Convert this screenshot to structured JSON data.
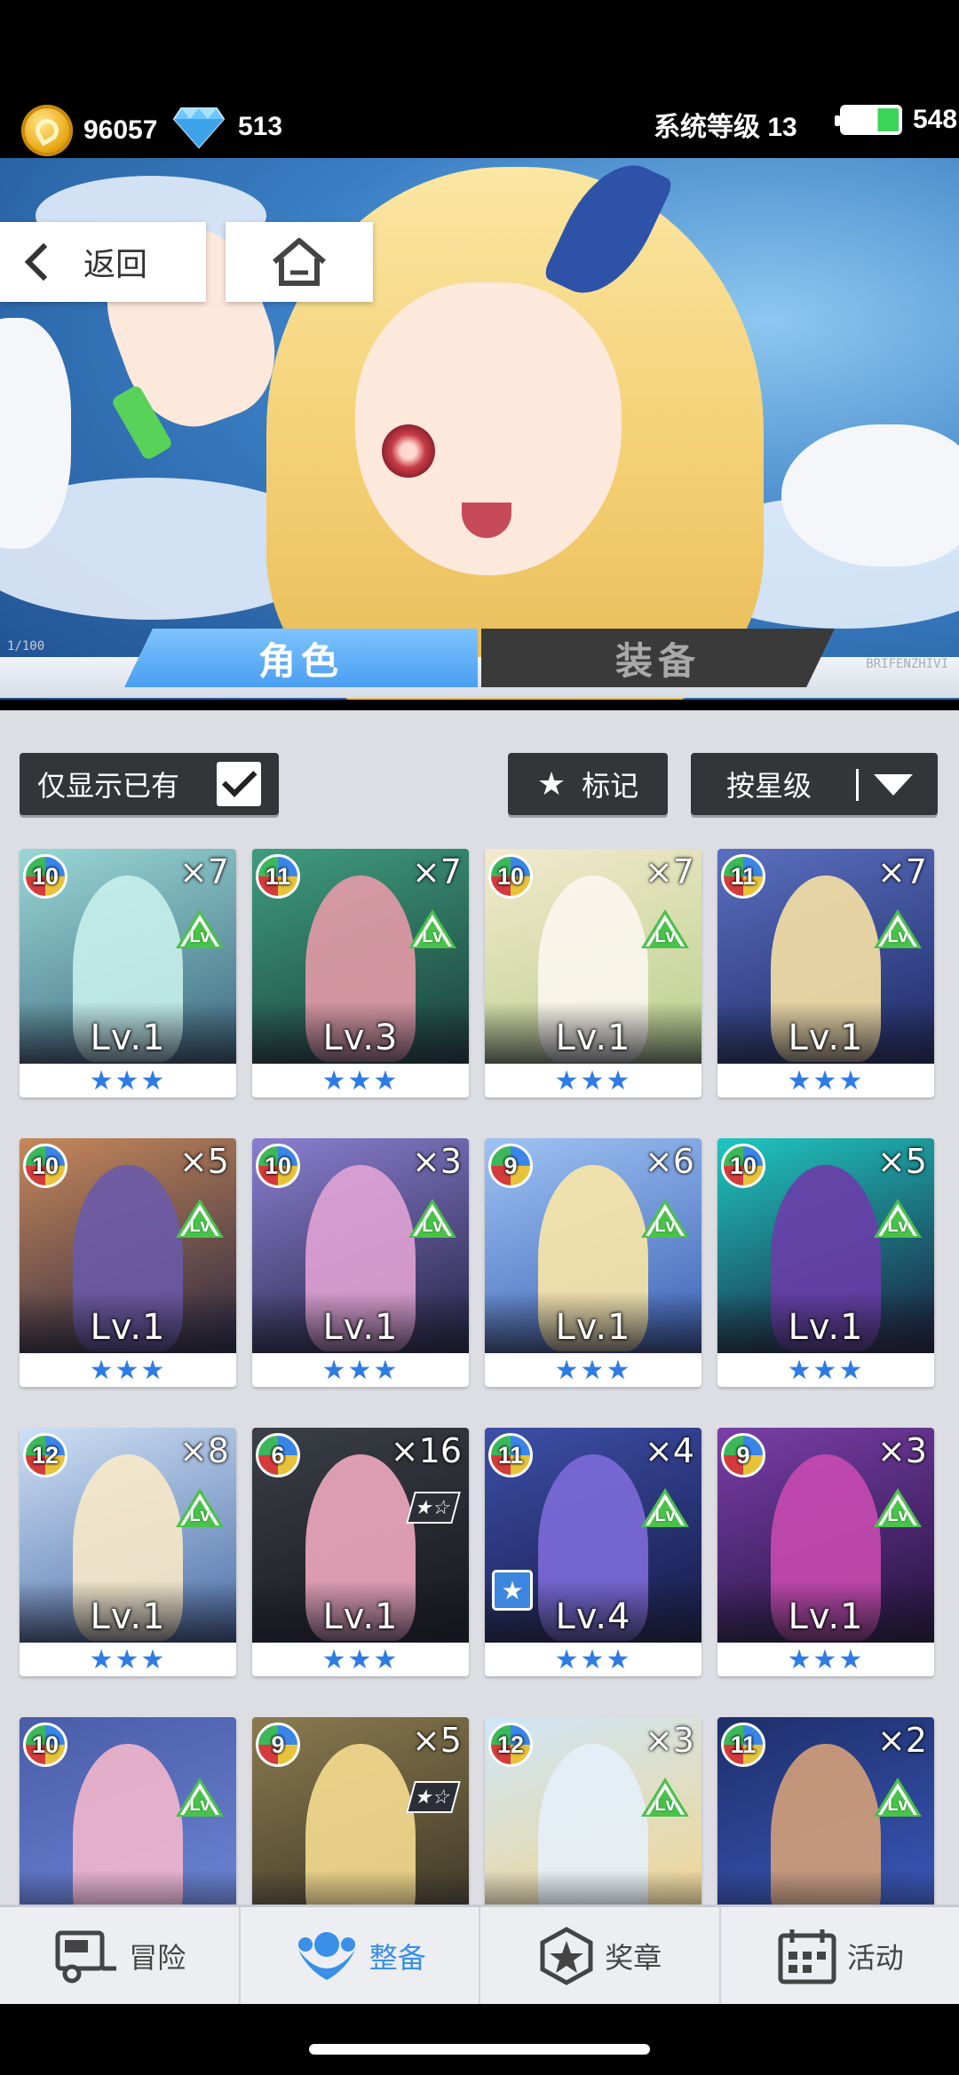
{
  "status": {
    "gold": "96057",
    "gems": "513",
    "system_level_label": "系统等级 13",
    "stamina": "548",
    "icons": {
      "gold": "gold-coin-icon",
      "gems": "diamond-icon",
      "stamina": "battery-icon"
    }
  },
  "header": {
    "back_label": "返回",
    "home_icon": "home-icon",
    "left_tag": "1/100",
    "right_tag": "BRIFENZHIVI"
  },
  "tabs": [
    {
      "label": "角色",
      "active": true
    },
    {
      "label": "装备",
      "active": false
    }
  ],
  "filters": {
    "owned_label": "仅显示已有",
    "owned_checked": true,
    "mark_label": "标记",
    "sort_label": "按星级"
  },
  "cards": [
    {
      "level_badge": "10",
      "count": "×7",
      "lv": "Lv.1",
      "stars": "★★★",
      "art": [
        "#9ad7d5",
        "#3e6a80"
      ],
      "fig": "#c7f0ea",
      "badge": "lv"
    },
    {
      "level_badge": "11",
      "count": "×7",
      "lv": "Lv.3",
      "stars": "★★★",
      "art": [
        "#3f9c7e",
        "#1b3f3a"
      ],
      "fig": "#e49aa8",
      "badge": "lv"
    },
    {
      "level_badge": "10",
      "count": "×7",
      "lv": "Lv.1",
      "stars": "★★★",
      "art": [
        "#f3e9cf",
        "#b9d08a"
      ],
      "fig": "#fbf6ee",
      "badge": "lv"
    },
    {
      "level_badge": "11",
      "count": "×7",
      "lv": "Lv.1",
      "stars": "★★★",
      "art": [
        "#5b6fc0",
        "#1d2a66"
      ],
      "fig": "#f7e1a4",
      "badge": "lv"
    },
    {
      "level_badge": "10",
      "count": "×5",
      "lv": "Lv.1",
      "stars": "★★★",
      "art": [
        "#c6885a",
        "#2b2740"
      ],
      "fig": "#6a5aa8",
      "badge": "lv"
    },
    {
      "level_badge": "10",
      "count": "×3",
      "lv": "Lv.1",
      "stars": "★★★",
      "art": [
        "#8a7fd0",
        "#262244"
      ],
      "fig": "#e0a3d4",
      "badge": "lv"
    },
    {
      "level_badge": "9",
      "count": "×6",
      "lv": "Lv.1",
      "stars": "★★★",
      "art": [
        "#9ec3f3",
        "#3c62b6"
      ],
      "fig": "#fbe7a6",
      "badge": "lv"
    },
    {
      "level_badge": "10",
      "count": "×5",
      "lv": "Lv.1",
      "stars": "★★★",
      "art": [
        "#1fc7c0",
        "#1a1a3a"
      ],
      "fig": "#6a3da8",
      "badge": "lv"
    },
    {
      "level_badge": "12",
      "count": "×8",
      "lv": "Lv.1",
      "stars": "★★★",
      "art": [
        "#cfe0f5",
        "#4b6ea8"
      ],
      "fig": "#f7e9c8",
      "badge": "lv"
    },
    {
      "level_badge": "6",
      "count": "×16",
      "lv": "Lv.1",
      "stars": "★★★",
      "art": [
        "#3b3f46",
        "#15171c"
      ],
      "fig": "#f0a8c0",
      "badge": "star"
    },
    {
      "level_badge": "11",
      "count": "×4",
      "lv": "Lv.4",
      "stars": "★★★",
      "art": [
        "#3d4fa8",
        "#151a45"
      ],
      "fig": "#7d6ad8",
      "badge": "lv",
      "marked": true
    },
    {
      "level_badge": "9",
      "count": "×3",
      "lv": "Lv.1",
      "stars": "★★★",
      "art": [
        "#7a3fa8",
        "#23123f"
      ],
      "fig": "#c84ab0",
      "badge": "lv"
    },
    {
      "level_badge": "10",
      "count": "",
      "lv": "",
      "stars": "",
      "art": [
        "#4a5ca8",
        "#6d87d6"
      ],
      "fig": "#f3b6cc",
      "badge": "lv"
    },
    {
      "level_badge": "9",
      "count": "×5",
      "lv": "",
      "stars": "",
      "art": [
        "#8a7a4f",
        "#3b3426"
      ],
      "fig": "#f5dc8f",
      "badge": "star"
    },
    {
      "level_badge": "12",
      "count": "×3",
      "lv": "",
      "stars": "",
      "art": [
        "#cfe6f7",
        "#f3d48a"
      ],
      "fig": "#e6eff8",
      "badge": "lv"
    },
    {
      "level_badge": "11",
      "count": "×2",
      "lv": "",
      "stars": "",
      "art": [
        "#1e2e6a",
        "#3c5bbf"
      ],
      "fig": "#d4a079",
      "badge": "lv"
    }
  ],
  "lv_badge_text": "Lv",
  "star_badge_text": "★☆",
  "mark_badge_text": "★",
  "nav": [
    {
      "label": "冒险",
      "icon": "truck-icon",
      "active": false
    },
    {
      "label": "整备",
      "icon": "gear-character-icon",
      "active": true
    },
    {
      "label": "奖章",
      "icon": "medal-icon",
      "active": false
    },
    {
      "label": "活动",
      "icon": "calendar-icon",
      "active": false
    }
  ],
  "colors": {
    "accent": "#4a9ef0",
    "star": "#2e7be3",
    "lvup": "#49c24a"
  }
}
